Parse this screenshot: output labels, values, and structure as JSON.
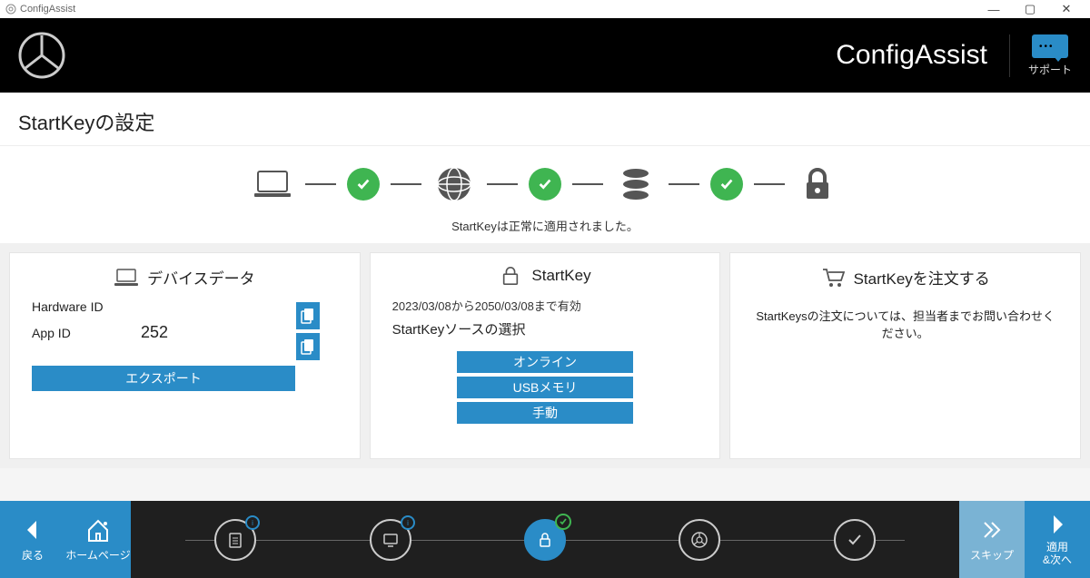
{
  "window": {
    "title": "ConfigAssist"
  },
  "header": {
    "app_name": "ConfigAssist",
    "support_label": "サポート"
  },
  "page": {
    "title": "StartKeyの設定"
  },
  "progress": {
    "message": "StartKeyは正常に適用されました。"
  },
  "device_card": {
    "title": "デバイスデータ",
    "hardware_id_label": "Hardware ID",
    "hardware_id_value": "",
    "app_id_label": "App ID",
    "app_id_value": "252",
    "export_label": "エクスポート"
  },
  "startkey_card": {
    "title": "StartKey",
    "valid_text": "2023/03/08から2050/03/08まで有効",
    "source_label": "StartKeyソースの選択",
    "online_label": "オンライン",
    "usb_label": "USBメモリ",
    "manual_label": "手動"
  },
  "order_card": {
    "title": "StartKeyを注文する",
    "message": "StartKeysの注文については、担当者までお問い合わせください。"
  },
  "footer": {
    "back_label": "戻る",
    "home_label": "ホームページ",
    "skip_label": "スキップ",
    "apply_next_label": "適用\n&次へ"
  }
}
